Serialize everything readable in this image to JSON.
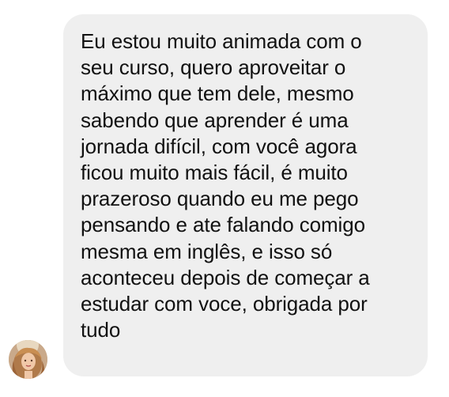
{
  "conversation": {
    "message": {
      "sender_avatar_icon": "user-avatar-photo",
      "bubble_color": "#efefef",
      "lines": [
        "Eu estou muito animada com o",
        "seu curso, quero aproveitar o",
        "máximo que tem dele, mesmo",
        "sabendo que aprender é uma",
        "jornada difícil, com você agora",
        "ficou muito mais fácil, é muito",
        "prazeroso quando eu me pego",
        "pensando e ate falando comigo",
        "mesma em inglês, e isso só",
        "aconteceu depois de começar a",
        "estudar com voce, obrigada por",
        "tudo"
      ]
    }
  }
}
